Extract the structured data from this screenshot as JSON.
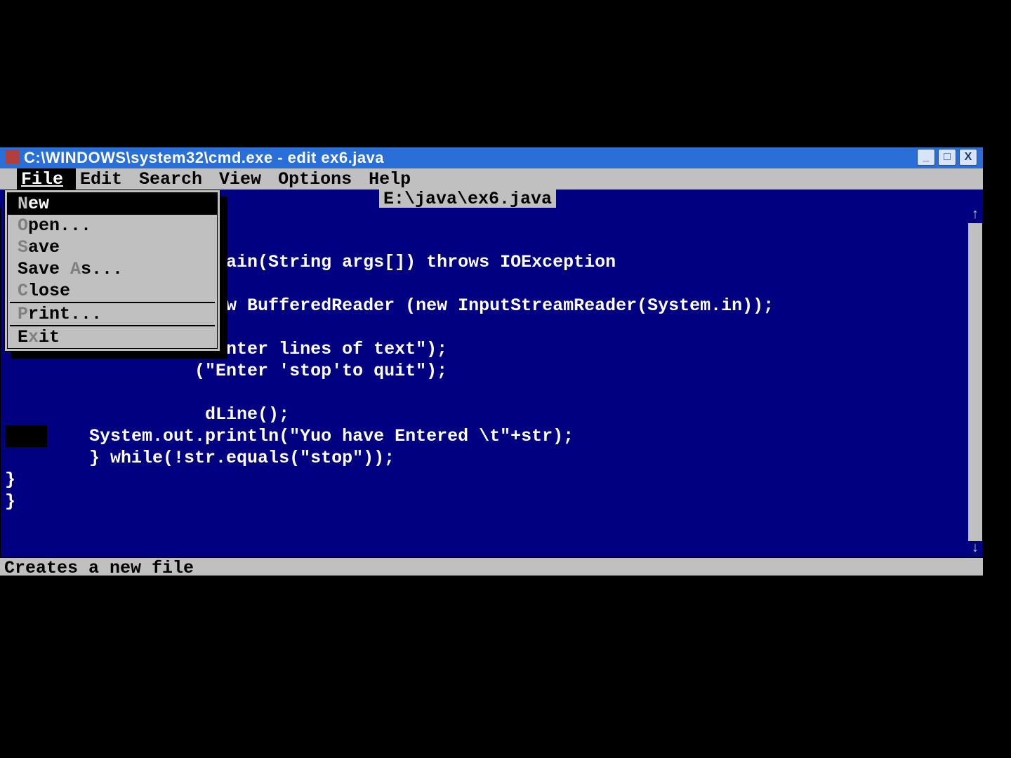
{
  "window": {
    "title": "C:\\WINDOWS\\system32\\cmd.exe - edit ex6.java"
  },
  "menubar": {
    "items": [
      {
        "label": "File",
        "hotkey": "F",
        "active": true
      },
      {
        "label": "Edit",
        "hotkey": "E",
        "active": false
      },
      {
        "label": "Search",
        "hotkey": "S",
        "active": false
      },
      {
        "label": "View",
        "hotkey": "V",
        "active": false
      },
      {
        "label": "Options",
        "hotkey": "O",
        "active": false
      },
      {
        "label": "Help",
        "hotkey": "H",
        "active": false
      }
    ]
  },
  "path": "E:\\java\\ex6.java",
  "dropdown": {
    "open_under": "File",
    "groups": [
      [
        {
          "label": "New",
          "hotkey": "N",
          "selected": true
        },
        {
          "label": "Open...",
          "hotkey": "O",
          "selected": false
        },
        {
          "label": "Save",
          "hotkey": "S",
          "selected": false
        },
        {
          "label": "Save As...",
          "hotkey": "A",
          "selected": false
        },
        {
          "label": "Close",
          "hotkey": "C",
          "selected": false
        }
      ],
      [
        {
          "label": "Print...",
          "hotkey": "P",
          "selected": false
        }
      ],
      [
        {
          "label": "Exit",
          "hotkey": "x",
          "selected": false
        }
      ]
    ]
  },
  "code": {
    "lines": [
      "",
      "                    main(String args[]) throws IOException",
      "",
      "                   new BufferedReader (new InputStreamReader(System.in));",
      "",
      "                  (\"Enter lines of text\");",
      "                  (\"Enter 'stop'to quit\");",
      "",
      "                   dLine();",
      "        System.out.println(\"Yuo have Entered \\t\"+str);",
      "        } while(!str.equals(\"stop\"));",
      "}",
      "}"
    ]
  },
  "status": "Creates a new file"
}
